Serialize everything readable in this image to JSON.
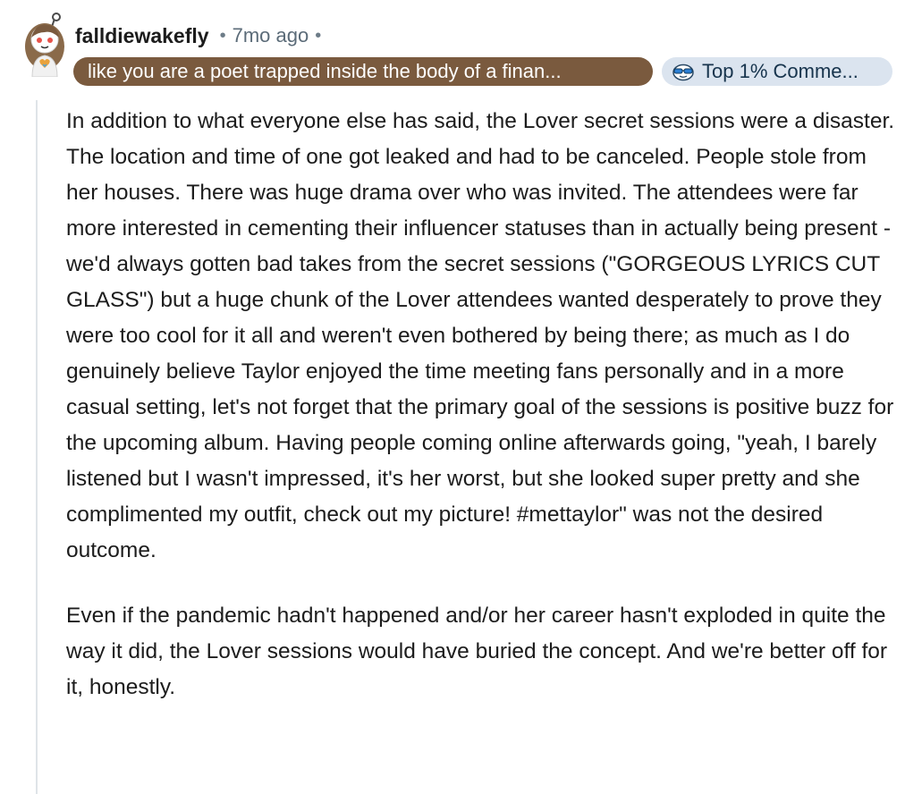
{
  "comment": {
    "author": "falldiewakefly",
    "separator": "•",
    "timestamp": "7mo ago",
    "flair": "like you are a poet trapped inside the body of a finan...",
    "badge": {
      "label": "Top 1% Comme...",
      "icon": "snoo-sunglasses-icon"
    },
    "paragraphs": [
      "In addition to what everyone else has said, the Lover secret sessions were a disaster. The location and time of one got leaked and had to be canceled. People stole from her houses. There was huge drama over who was invited. The attendees were far more interested in cementing their influencer statuses than in actually being present - we'd always gotten bad takes from the secret sessions (\"GORGEOUS LYRICS CUT GLASS\") but a huge chunk of the Lover attendees wanted desperately to prove they were too cool for it all and weren't even bothered by being there; as much as I do genuinely believe Taylor enjoyed the time meeting fans personally and in a more casual setting, let's not forget that the primary goal of the sessions is positive buzz for the upcoming album. Having people coming online afterwards going, \"yeah, I barely listened but I wasn't impressed, it's her worst, but she looked super pretty and she complimented my outfit, check out my picture! #mettaylor\" was not the desired outcome.",
      "Even if the pandemic hadn't happened and/or her career hasn't exploded in quite the way it did, the Lover sessions would have buried the concept. And we're better off for it, honestly."
    ]
  },
  "colors": {
    "flair_bg": "#7a5a3e",
    "badge_bg": "#dbe4ef",
    "thread_line": "#dfe4e8",
    "meta_text": "#5b6b78"
  }
}
